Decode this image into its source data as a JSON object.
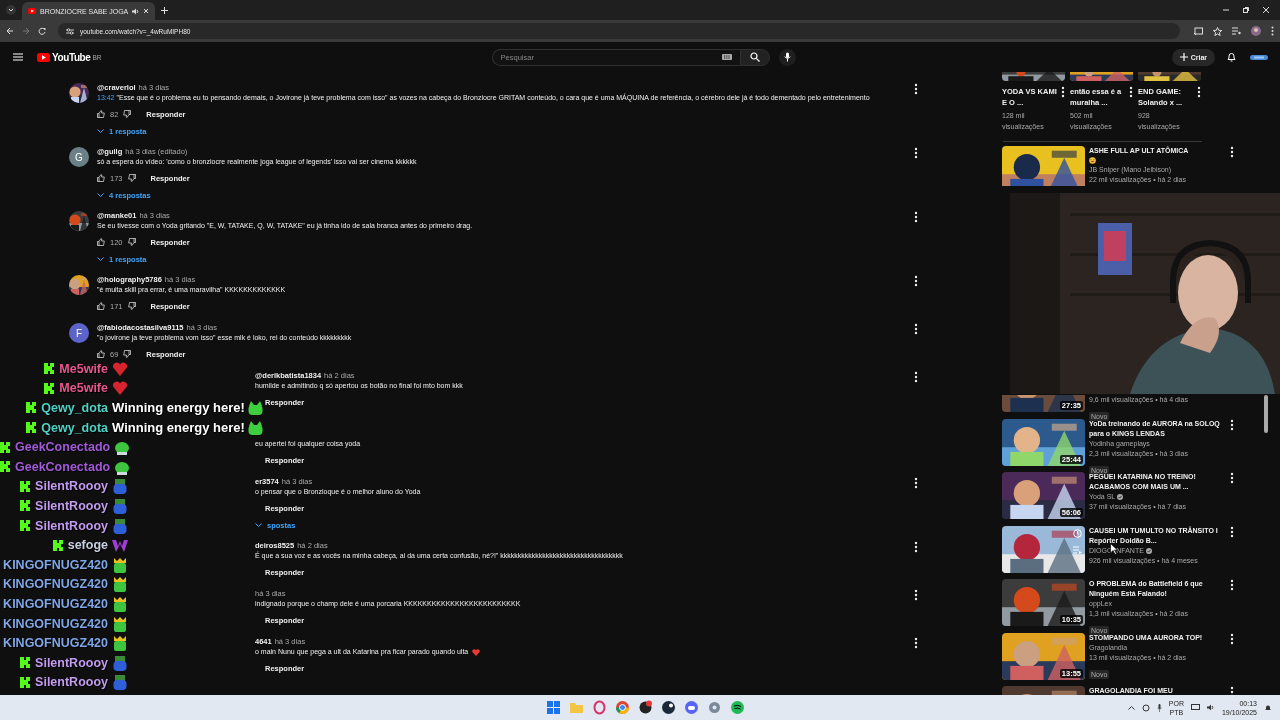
{
  "browser": {
    "tab_title": "BRONZIOCRE SABE JOGA",
    "url": "youtube.com/watch?v=_4wRuMIPH80"
  },
  "header": {
    "logo": "YouTube",
    "region": "BR",
    "search_placeholder": "Pesquisar",
    "create": "Criar"
  },
  "comments": [
    {
      "author": "@craverlol",
      "time": "há 3 dias",
      "timestamp": "13:42",
      "text": "\"Esse que é o problema eu to pensando demais, o Jovirone já teve problema com isso\" as vozes na cabeça do Bronziocre GRITAM conteúdo, o cara que é uma MÁQUINA de referência, o cérebro dele já é todo dementado pelo entretenimento",
      "likes": "82",
      "reply": "Responder",
      "replies": "1 resposta"
    },
    {
      "initial": "G",
      "color": "#6b7f86",
      "author": "@guilg",
      "time": "há 3 dias (editado)",
      "text": "só a espera do vídeo: 'como o bronziocre realmente joga league of legends' isso vai ser cinema kkkkkk",
      "likes": "173",
      "reply": "Responder",
      "replies": "4 respostas"
    },
    {
      "author": "@manke01",
      "time": "há 3 dias",
      "text": "Se eu tivesse com o Yoda gritando \"E, W, TATAKE, Q, W, TATAKE\" eu já tinha ido de sala branca antes do primeiro drag.",
      "likes": "120",
      "reply": "Responder",
      "replies": "1 resposta"
    },
    {
      "author": "@holography5786",
      "time": "há 3 dias",
      "text": "\"é muita skill pra errar, é uma maravilha\" KKKKKKKKKKKKK",
      "likes": "171",
      "reply": "Responder"
    },
    {
      "initial": "F",
      "color": "#5c63c9",
      "author": "@fabiodacostasilva9115",
      "time": "há 3 dias",
      "text": "\"o jovirone ja teve problema vom isso\" esse mlk é loko, rei do conteúdo kkkkkkkkk",
      "likes": "69",
      "reply": "Responder"
    }
  ],
  "partial_comments": [
    {
      "author": "@derikbatista1834",
      "time": "há 2 dias",
      "text": "humilde e admitindo q só apertou os botão no final foi mto bom kkk",
      "reply": "Responder",
      "heart": false
    },
    {
      "text": "eu apertei foi qualquer coisa yoda",
      "reply": "Responder",
      "heart": false
    },
    {
      "author": "er3574",
      "time": "há 3 dias",
      "text": "o pensar que o Bronzioque é o melhor aluno do Yoda",
      "reply": "Responder",
      "replies": "spostas",
      "heart": false
    },
    {
      "author": "deiros8525",
      "time": "há 2 dias",
      "text": "É que a sua voz e as vocês na minha cabeça, ai da uma certa confusão, né?!\" kkkkkkkkkkkkkkkkkkkkkkkkkkkkkkkkkkk",
      "reply": "Responder",
      "heart": false
    },
    {
      "time": "há 3 dias",
      "text": "indignado porque o champ dele é uma porcaria KKKKKKKKKKKKKKKKKKKKKKKKK",
      "reply": "Responder",
      "heart": false
    },
    {
      "author": "4641",
      "time": "há 3 dias",
      "text": "o main Nunu que pega a ult da Katarina pra ficar parado quando ulta",
      "reply": "Responder",
      "heart": true
    }
  ],
  "chat": [
    {
      "user": "Me5wife",
      "badge": true,
      "color": "#e8578c",
      "kind": "heart"
    },
    {
      "user": "Me5wife",
      "badge": true,
      "color": "#e8578c",
      "kind": "heart"
    },
    {
      "user": "Qewy_dota",
      "badge": true,
      "color": "#4fd1c5",
      "message": "Winning energy here!",
      "kind": "cat"
    },
    {
      "user": "Qewy_dota",
      "badge": true,
      "color": "#4fd1c5",
      "message": "Winning energy here!",
      "kind": "cat"
    },
    {
      "user": "GeekConectado",
      "badge": true,
      "color": "#a25ad9",
      "kind": "frog"
    },
    {
      "user": "GeekConectado",
      "badge": true,
      "color": "#a25ad9",
      "kind": "frog"
    },
    {
      "user": "SilentRoooy",
      "badge": true,
      "color": "#c39bf0",
      "kind": "blue"
    },
    {
      "user": "SilentRoooy",
      "badge": true,
      "color": "#c39bf0",
      "kind": "blue"
    },
    {
      "user": "SilentRoooy",
      "badge": true,
      "color": "#c39bf0",
      "kind": "blue"
    },
    {
      "user": "sefoge",
      "badge": true,
      "color": "#c8d0e0",
      "kind": "purple"
    },
    {
      "user": "KINGOFNUGZ420",
      "badge": false,
      "color": "#7fa6e6",
      "kind": "crown"
    },
    {
      "user": "KINGOFNUGZ420",
      "badge": false,
      "color": "#7fa6e6",
      "kind": "crown"
    },
    {
      "user": "KINGOFNUGZ420",
      "badge": false,
      "color": "#7fa6e6",
      "kind": "crown"
    },
    {
      "user": "KINGOFNUGZ420",
      "badge": false,
      "color": "#7fa6e6",
      "kind": "crown"
    },
    {
      "user": "KINGOFNUGZ420",
      "badge": false,
      "color": "#7fa6e6",
      "kind": "crown"
    },
    {
      "user": "SilentRoooy",
      "badge": true,
      "color": "#c39bf0",
      "kind": "blue"
    },
    {
      "user": "SilentRoooy",
      "badge": true,
      "color": "#c39bf0",
      "kind": "blue"
    }
  ],
  "sidebar": {
    "shorts": [
      {
        "title": "YODA VS KAMI E O ...",
        "views": "128 mil visualizações"
      },
      {
        "title": "então essa é a muralha ...",
        "views": "502 mil visualizações"
      },
      {
        "title": "END GAME: Solando x ...",
        "views": "928 visualizações"
      }
    ],
    "featured": {
      "title": "ASHE FULL AP ULT ATÔMICA",
      "emoji": true,
      "channel": "JB Sniper (Mano Jeibison)",
      "views": "22 mil visualizações • há 2 dias"
    },
    "videos": [
      {
        "views": "9,6 mil visualizações • há 4 dias",
        "new": "Novo",
        "duration": "27:35",
        "verified": false,
        "hovered": false
      },
      {
        "title": "YoDa treinando de AURORA na SOLOQ para o KINGS LENDAS",
        "channel": "Yodinha gameplays",
        "views": "2,3 mil visualizações • há 3 dias",
        "new": "Novo",
        "duration": "25:44",
        "verified": false,
        "hovered": false
      },
      {
        "title": "PEGUEI KATARINA NO TREINO! ACABAMOS COM MAIS UM ...",
        "channel": "Yoda SL",
        "views": "37 mil visualizações • há 7 dias",
        "duration": "56:06",
        "verified": true,
        "hovered": false
      },
      {
        "title": "CAUSEI UM TUMULTO NO TRÂNSITO I Repórter Doidão B...",
        "channel": "DIOGO INFANTE",
        "views": "926 mil visualizações • há 4 meses",
        "verified": true,
        "hovered": true
      },
      {
        "title": "O PROBLEMA do Battlefield 6 que Ninguém Está Falando!",
        "channel": "oppLex",
        "views": "1,3 mil visualizações • há 2 dias",
        "new": "Novo",
        "duration": "10:35",
        "verified": false,
        "hovered": false
      },
      {
        "title": "STOMPANDO UMA AURORA TOP!",
        "channel": "Gragolandia",
        "views": "13 mil visualizações • há 2 dias",
        "new": "Novo",
        "duration": "13:55",
        "verified": false,
        "hovered": false
      },
      {
        "title": "GRAGOLANDIA FOI MEU",
        "verified": false,
        "hovered": false
      }
    ]
  },
  "taskbar": {
    "language": "POR",
    "layout": "PTB",
    "time": "00:13",
    "date": "19/10/2025"
  }
}
